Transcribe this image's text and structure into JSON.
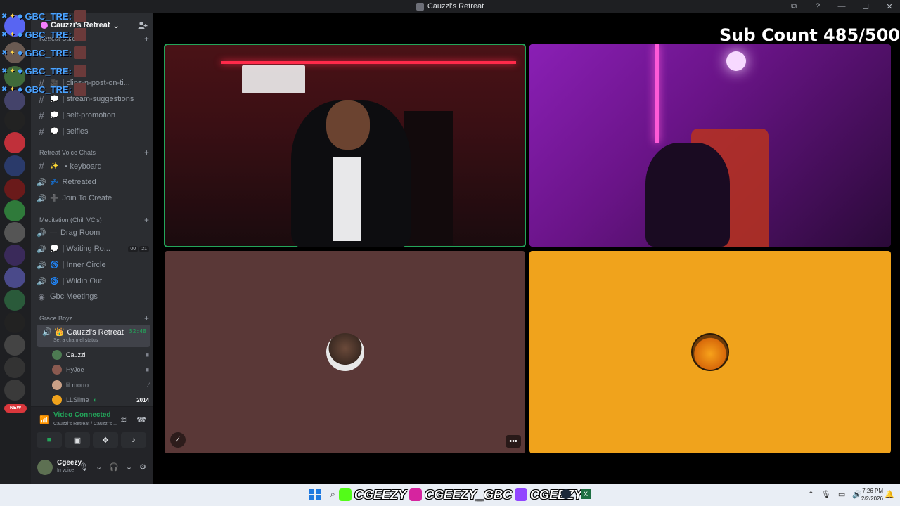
{
  "window": {
    "title": "Cauzzi's Retreat",
    "controls": [
      "⧉",
      "?",
      "—",
      "☐",
      "✕"
    ]
  },
  "overlay": {
    "tags": [
      "GBC_TRE:",
      "GBC_TRE:",
      "GBC_TRE:",
      "GBC_TRE:",
      "GBC_TRE:"
    ]
  },
  "server": {
    "name": "Cauzzi's Retreat",
    "categories": {
      "retreat_care": "Retreat Care",
      "voice_chats": "Retreat Voice Chats",
      "meditation": "Meditation (Chill VC's)",
      "grace_boyz": "Grace Boyz"
    },
    "text_channels": [
      {
        "name": "| clips-n-post-on-ti...",
        "emoji": "🎥"
      },
      {
        "name": "| stream-suggestions",
        "emoji": "💭"
      },
      {
        "name": "| self-promotion",
        "emoji": "💭"
      },
      {
        "name": "| selfies",
        "emoji": "💭"
      }
    ],
    "voice_chats": [
      {
        "name": "・keyboard",
        "emoji": "✨",
        "kind": "#"
      },
      {
        "name": "Retreated",
        "emoji": "💤",
        "kind": "🔊"
      },
      {
        "name": "Join To Create",
        "emoji": "➕",
        "kind": "🔊"
      }
    ],
    "meditation_channels": [
      {
        "name": "Drag Room",
        "emoji": "—"
      },
      {
        "name": "| Waiting Ro...",
        "emoji": "💭",
        "badges": [
          "00",
          "21"
        ]
      },
      {
        "name": "| Inner Circle",
        "emoji": "🌀"
      },
      {
        "name": "| Wildin Out",
        "emoji": "🌀"
      },
      {
        "name": "Gbc Meetings",
        "emoji": ""
      }
    ],
    "active_voice": {
      "name": "Cauzzi's Retreat",
      "time": "52:48",
      "status": "Set a channel status"
    },
    "voice_users": [
      {
        "name": "Cauzzi",
        "icon": "▶",
        "color": "#4d7a52"
      },
      {
        "name": "HyJoe",
        "icon": "▶",
        "color": "#8a5a50"
      },
      {
        "name": "lil morro",
        "icon": "⁄",
        "color": "#c9a087"
      },
      {
        "name": "LLSlime",
        "icon": "2014",
        "color": "#f0a31c"
      }
    ]
  },
  "rail": {
    "new_badge": "NEW"
  },
  "voice_panel": {
    "title": "Video Connected",
    "subtitle": "Cauzzi's Retreat / Cauzzi's ..."
  },
  "user": {
    "name": "Cgeezy",
    "status": "In voice"
  },
  "stage": {
    "sub_count": "Sub Count 485/500"
  },
  "taskbar": {
    "banner_1": "CGEEZY",
    "banner_2": "CGEEZY_GBC",
    "banner_3": "CGEEZY",
    "time": "7:26 PM",
    "date": "2/2/2026"
  }
}
